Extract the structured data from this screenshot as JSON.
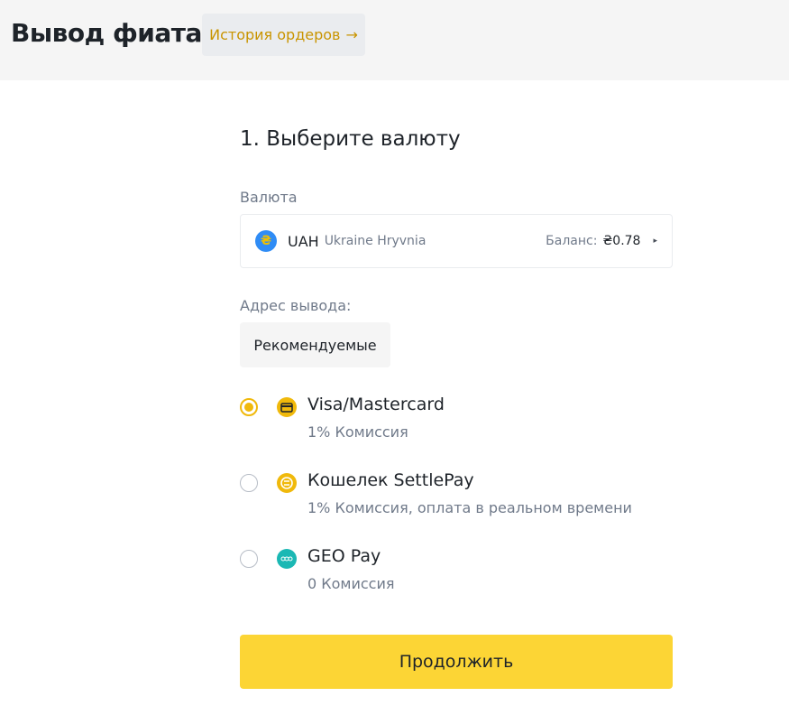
{
  "header": {
    "title": "Вывод фиата",
    "history_label": "История ордеров",
    "history_arrow": "→"
  },
  "step": {
    "title": "1. Выберите валюту"
  },
  "currency": {
    "label": "Валюта",
    "icon": "hryvnia-coin-icon",
    "icon_glyph": "₴",
    "code": "UAH",
    "name": "Ukraine Hryvnia",
    "balance_label": "Баланс:",
    "balance_value": "₴0.78",
    "caret": "▸"
  },
  "withdraw": {
    "label": "Адрес вывода:",
    "tab_label": "Рекомендуемые",
    "methods": [
      {
        "icon": "card-icon",
        "title": "Visa/Mastercard",
        "desc": "1% Комиссия",
        "selected": true
      },
      {
        "icon": "settlepay-icon",
        "title": "Кошелек SettlePay",
        "desc": "1% Комиссия, оплата в реальном времени",
        "selected": false
      },
      {
        "icon": "geopay-icon",
        "title": "GEO Pay",
        "desc": "0 Комиссия",
        "selected": false
      }
    ]
  },
  "continue_label": "Продолжить",
  "colors": {
    "accent": "#f0b90b",
    "button": "#fcd535",
    "link": "#c99400",
    "geo_pay": "#1bb8b4",
    "uah_blue": "#2f8cf5"
  }
}
